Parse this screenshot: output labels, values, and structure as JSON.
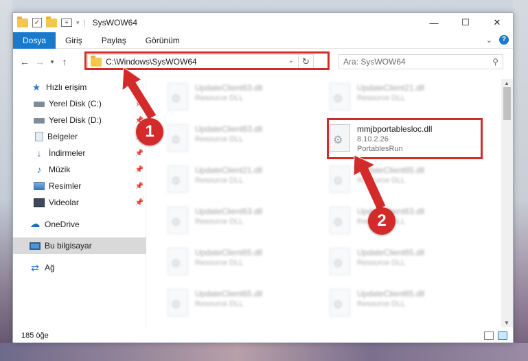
{
  "window": {
    "title": "SysWOW64"
  },
  "ribbon": {
    "tabs": [
      {
        "label": "Dosya",
        "active": true
      },
      {
        "label": "Giriş",
        "active": false
      },
      {
        "label": "Paylaş",
        "active": false
      },
      {
        "label": "Görünüm",
        "active": false
      }
    ]
  },
  "address": {
    "path": "C:\\Windows\\SysWOW64"
  },
  "search": {
    "placeholder": "Ara: SysWOW64"
  },
  "sidebar": {
    "items": [
      {
        "label": "Hızlı erişim",
        "icon": "star-icon"
      },
      {
        "label": "Yerel Disk (C:)",
        "icon": "drive-icon"
      },
      {
        "label": "Yerel Disk (D:)",
        "icon": "drive-icon"
      },
      {
        "label": "Belgeler",
        "icon": "documents-icon"
      },
      {
        "label": "İndirmeler",
        "icon": "download-icon"
      },
      {
        "label": "Müzik",
        "icon": "music-icon"
      },
      {
        "label": "Resimler",
        "icon": "pictures-icon"
      },
      {
        "label": "Videolar",
        "icon": "videos-icon"
      },
      {
        "label": "OneDrive",
        "icon": "cloud-icon"
      },
      {
        "label": "Bu bilgisayar",
        "icon": "computer-icon",
        "selected": true
      },
      {
        "label": "Ağ",
        "icon": "network-icon"
      }
    ]
  },
  "files": {
    "left": [
      {
        "name": "UpdateClient63.dll",
        "type": "Resource DLL"
      },
      {
        "name": "UpdateClient63.dll",
        "type": "Resource DLL"
      },
      {
        "name": "UpdateClient21.dll",
        "type": "Resource DLL"
      },
      {
        "name": "UpdateClient63.dll",
        "type": "Resource DLL"
      },
      {
        "name": "UpdateClient65.dll",
        "type": "Resource DLL"
      },
      {
        "name": "UpdateClient65.dll",
        "type": "Resource DLL"
      }
    ],
    "right": [
      {
        "name": "UpdateClient21.dll",
        "type": "Resource DLL"
      },
      {
        "name": "UpdateClient65.dll",
        "type": "Resource DLL"
      },
      {
        "name": "UpdateClient63.dll",
        "type": "Resource DLL"
      },
      {
        "name": "UpdateClient65.dll",
        "type": "Resource DLL"
      },
      {
        "name": "UpdateClient65.dll",
        "type": "Resource DLL"
      }
    ],
    "highlighted": {
      "name": "mmjbportablesloc.dll",
      "version": "8.10.2.26",
      "company": "PortablesRun"
    }
  },
  "status": {
    "count": "185 öğe"
  },
  "annotations": {
    "step1": "1",
    "step2": "2",
    "color": "#d32a2a"
  }
}
